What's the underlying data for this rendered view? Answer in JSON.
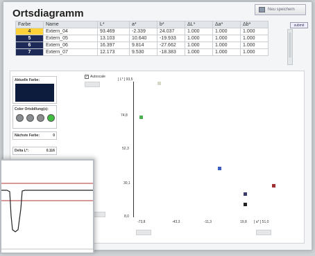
{
  "title": "Ortsdiagramm",
  "save_button": "Neu speichern",
  "submit_button": "submit",
  "table": {
    "headers": [
      "Farbe",
      "Name",
      "L*",
      "a*",
      "b*",
      "ΔL*",
      "Δa*",
      "Δb*"
    ],
    "rows": [
      {
        "farbe": "4",
        "name": "Extern_04",
        "L": "93.469",
        "a": "-2.339",
        "b": "24.037",
        "dL": "1.000",
        "da": "1.000",
        "db": "1.000"
      },
      {
        "farbe": "5",
        "name": "Extern_05",
        "L": "13.103",
        "a": "10.640",
        "b": "-19.933",
        "dL": "1.000",
        "da": "1.000",
        "db": "1.000"
      },
      {
        "farbe": "6",
        "name": "Extern_06",
        "L": "16.397",
        "a": "9.814",
        "b": "-27.662",
        "dL": "1.000",
        "da": "1.000",
        "db": "1.000"
      },
      {
        "farbe": "7",
        "name": "Extern_07",
        "L": "12.173",
        "a": "9.530",
        "b": "-18.383",
        "dL": "1.000",
        "da": "1.000",
        "db": "1.000"
      }
    ]
  },
  "aktuelle_farbe": "Aktuelle Farbe:",
  "ortsbill": "Color Ortsbillung(s):",
  "naechste_label": "Nächste Farbe:",
  "naechste_value": "0",
  "delta_label": "Delta L*:",
  "delta_value": "0.116",
  "autoscale": "Autoscale",
  "chart_data": {
    "type": "scatter",
    "ylabel": "[ L* ] 93,5",
    "xlabel": "[ a* ] 51,0",
    "yticks": [
      "74,8",
      "52,3",
      "30,1",
      "8,0"
    ],
    "xticks": [
      "-73,8",
      "-43,3",
      "-11,3",
      "19,8"
    ],
    "points": [
      {
        "x": -76,
        "y": 93.5,
        "color": "#d8d8c8"
      },
      {
        "x": -95,
        "y": 70,
        "color": "#4caf50"
      },
      {
        "x": -12,
        "y": 35,
        "color": "#3a5fbf"
      },
      {
        "x": 15,
        "y": 17,
        "color": "#3b3b6b"
      },
      {
        "x": 15,
        "y": 10,
        "color": "#222"
      },
      {
        "x": 45,
        "y": 23,
        "color": "#a03030"
      }
    ]
  }
}
